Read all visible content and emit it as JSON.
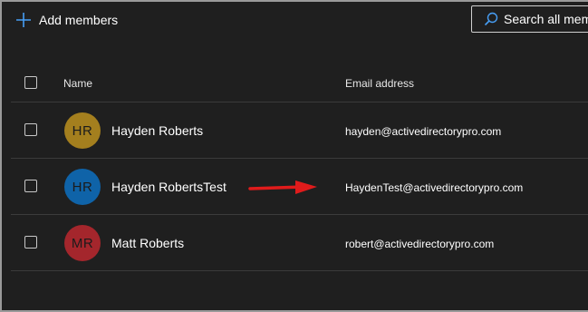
{
  "toolbar": {
    "add_members_label": "Add members",
    "add_icon": "plus-icon",
    "search_placeholder": "Search all mem",
    "search_icon": "search-icon"
  },
  "table": {
    "columns": [
      "Name",
      "Email address"
    ],
    "rows": [
      {
        "initials": "HR",
        "name": "Hayden Roberts",
        "email": "hayden@activedirectorypro.com",
        "avatar_color": "#a47f1e"
      },
      {
        "initials": "HR",
        "name": "Hayden RobertsTest",
        "email": "HaydenTest@activedirectorypro.com",
        "avatar_color": "#0f63a8"
      },
      {
        "initials": "MR",
        "name": "Matt Roberts",
        "email": "robert@activedirectorypro.com",
        "avatar_color": "#a4262c"
      }
    ]
  },
  "annotation": {
    "icon": "red-arrow-icon",
    "color": "#e01b1b"
  },
  "colors": {
    "background": "#1f1f1f",
    "accent": "#479ef5",
    "divider": "#3b3b3b"
  }
}
